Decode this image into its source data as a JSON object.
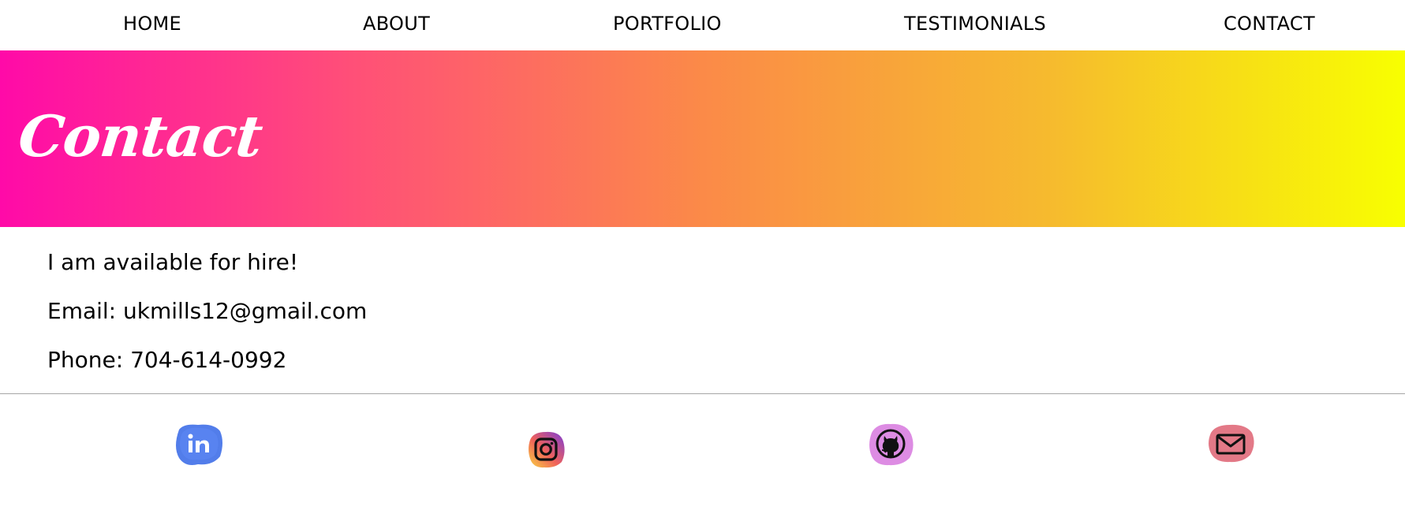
{
  "nav": {
    "items": [
      {
        "label": "HOME"
      },
      {
        "label": "ABOUT"
      },
      {
        "label": "PORTFOLIO"
      },
      {
        "label": "TESTIMONIALS"
      },
      {
        "label": "CONTACT"
      }
    ]
  },
  "banner": {
    "title": "Contact",
    "gradient_colors": [
      "#ff0aa8",
      "#ff4f78",
      "#fb8a48",
      "#f6bb2e",
      "#f8ff00"
    ]
  },
  "contact": {
    "availability": "I am available for hire!",
    "email": "Email: ukmills12@gmail.com",
    "phone": "Phone: 704-614-0992"
  },
  "social": [
    {
      "icon": "linkedin-icon",
      "color": "#3f6fe8"
    },
    {
      "icon": "instagram-icon",
      "color": "#c13584"
    },
    {
      "icon": "github-icon",
      "color": "#d97fe0"
    },
    {
      "icon": "mail-icon",
      "color": "#e06a7a"
    }
  ]
}
